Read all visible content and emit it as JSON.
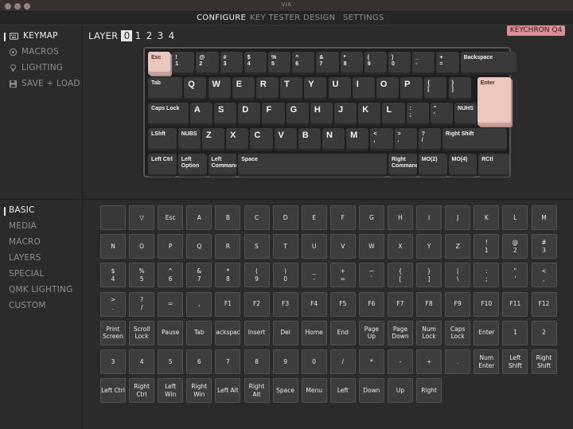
{
  "window": {
    "title": "VIA"
  },
  "menu": {
    "items": [
      "CONFIGURE",
      "KEY TESTER",
      "DESIGN",
      "SETTINGS"
    ],
    "active": 0
  },
  "sidebar_top": {
    "items": [
      {
        "label": "KEYMAP",
        "icon": "keyboard-icon"
      },
      {
        "label": "MACROS",
        "icon": "circle-dot-icon"
      },
      {
        "label": "LIGHTING",
        "icon": "lightbulb-icon"
      },
      {
        "label": "SAVE + LOAD",
        "icon": "save-icon"
      }
    ]
  },
  "layer": {
    "label": "LAYER",
    "numbers": [
      "0",
      "1",
      "2",
      "3",
      "4"
    ],
    "active": 0
  },
  "keyboard_name": "KEYCHRON Q4",
  "keyboard_keys": [
    [
      "Esc",
      "!\n1",
      "@\n2",
      "#\n3",
      "$\n4",
      "%\n5",
      "^\n6",
      "&\n7",
      "*\n8",
      "(\n9",
      ")\n0",
      "_\n-",
      "+\n=",
      "Backspace"
    ],
    [
      "Tab",
      "Q",
      "W",
      "E",
      "R",
      "T",
      "Y",
      "U",
      "I",
      "O",
      "P",
      "{\n[",
      "}\n]",
      "Enter"
    ],
    [
      "Caps Lock",
      "A",
      "S",
      "D",
      "F",
      "G",
      "H",
      "J",
      "K",
      "L",
      ":\n;",
      "\"\n'",
      "NUHS"
    ],
    [
      "LShft",
      "NUBS",
      "Z",
      "X",
      "C",
      "V",
      "B",
      "N",
      "M",
      "<\n,",
      ">\n.",
      "?\n/",
      "Right Shift"
    ],
    [
      "Left Ctrl",
      "Left\nOption",
      "Left\nCommand",
      "Space",
      "Right\nCommand",
      "MO(2)",
      "MO(4)",
      "RCtl"
    ]
  ],
  "sidebar_bottom": {
    "items": [
      "BASIC",
      "MEDIA",
      "MACRO",
      "LAYERS",
      "SPECIAL",
      "QMK LIGHTING",
      "CUSTOM"
    ],
    "active": 0
  },
  "palette": [
    [
      "",
      "▽",
      "Esc",
      "A",
      "B",
      "C",
      "D",
      "E",
      "F",
      "G",
      "H",
      "I",
      "J",
      "K",
      "L",
      "M"
    ],
    [
      "N",
      "O",
      "P",
      "Q",
      "R",
      "S",
      "T",
      "U",
      "V",
      "W",
      "X",
      "Y",
      "Z",
      "!\n1",
      "@\n2",
      "#\n3"
    ],
    [
      "$\n4",
      "%\n5",
      "^\n6",
      "&\n7",
      "*\n8",
      "(\n9",
      ")\n0",
      "_\n-",
      "+\n=",
      "~\n`",
      "{\n[",
      "}\n]",
      "|\n\\",
      ":\n;",
      "\"\n'",
      "<\n,"
    ],
    [
      ">\n.",
      "?\n/",
      "=",
      ",",
      "F1",
      "F2",
      "F3",
      "F4",
      "F5",
      "F6",
      "F7",
      "F8",
      "F9",
      "F10",
      "F11",
      "F12"
    ],
    [
      "Print\nScreen",
      "Scroll\nLock",
      "Pause",
      "Tab",
      "Backspace",
      "Insert",
      "Del",
      "Home",
      "End",
      "Page Up",
      "Page\nDown",
      "Num\nLock",
      "Caps\nLock",
      "Enter",
      "1",
      "2"
    ],
    [
      "3",
      "4",
      "5",
      "6",
      "7",
      "8",
      "9",
      "0",
      "/",
      "*",
      "-",
      "+",
      ".",
      "Num\nEnter",
      "Left\nShift",
      "Right\nShift"
    ],
    [
      "Left Ctrl",
      "Right\nCtrl",
      "Left Win",
      "Right\nWin",
      "Left Alt",
      "Right Alt",
      "Space",
      "Menu",
      "Left",
      "Down",
      "Up",
      "Right"
    ]
  ],
  "colors": {
    "accent": "#ecc7c0",
    "badge": "#d98f93",
    "background": "#2b2b2b"
  }
}
